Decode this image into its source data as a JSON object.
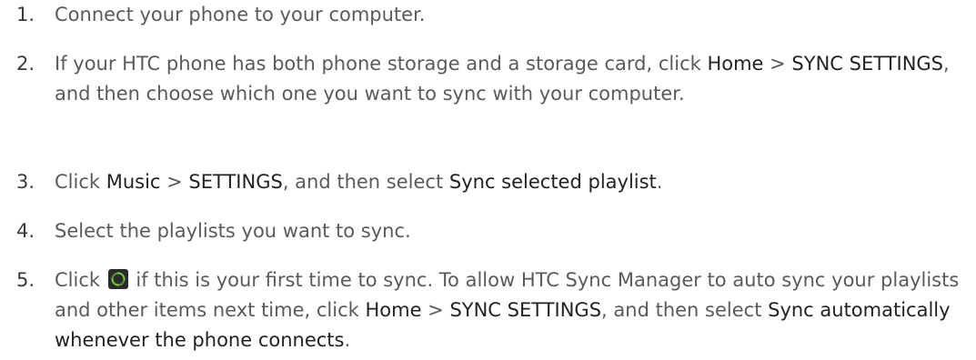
{
  "steps": [
    {
      "number": "1.",
      "parts": [
        "Connect your phone to your computer."
      ]
    },
    {
      "number": "2.",
      "parts": [
        "If your HTC phone has both phone storage and a storage card, click ",
        "Home",
        " > ",
        "SYNC SETTINGS",
        ", and then choose which one you want to sync with your computer."
      ]
    },
    {
      "number": "3.",
      "parts": [
        "Click ",
        "Music",
        " > ",
        "SETTINGS",
        ", and then select ",
        "Sync selected playlist",
        "."
      ]
    },
    {
      "number": "4.",
      "parts": [
        "Select the playlists you want to sync."
      ]
    },
    {
      "number": "5.",
      "parts": [
        "Click ",
        " if this is your first time to sync. To allow HTC Sync Manager to auto sync your playlists and other items next time, click ",
        "Home",
        " > ",
        "SYNC SETTINGS",
        ", and then select ",
        "Sync automatically whenever the phone connects",
        "."
      ]
    }
  ],
  "icons": {
    "sync": "sync-icon"
  },
  "colors": {
    "body_text": "#5a5a5a",
    "ui_term_text": "#222222",
    "sync_icon_background": "#2b2b2b",
    "sync_icon_green": "#6fd13f"
  }
}
